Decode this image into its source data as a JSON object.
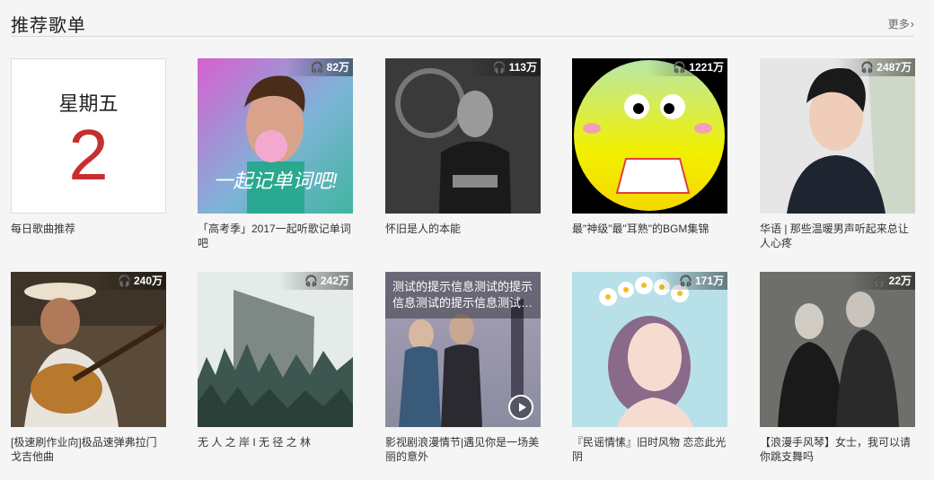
{
  "section": {
    "title": "推荐歌单",
    "more": "更多"
  },
  "daily": {
    "weekday": "星期五",
    "day": "2",
    "label": "每日歌曲推荐"
  },
  "playlists": [
    {
      "count": "82万",
      "label": "「高考季」2017一起听歌记单词吧",
      "cover_text": "一起记单词吧!"
    },
    {
      "count": "113万",
      "label": "怀旧是人的本能"
    },
    {
      "count": "1221万",
      "label": "最\"神级\"最\"耳熟\"的BGM集锦"
    },
    {
      "count": "2487万",
      "label": "华语 | 那些温暖男声听起来总让人心疼"
    },
    {
      "count": "240万",
      "label": "[极速刷作业向]极品速弹弗拉门戈吉他曲"
    },
    {
      "count": "242万",
      "label": "无 人 之 岸 I 无 径 之 林"
    },
    {
      "count": "",
      "label": "影视剧浪漫情节|遇见你是一场美丽的意外",
      "tooltip_line1": "测试的提示信息测试的提示",
      "tooltip_line2": "信息测试的提示信息测试的..."
    },
    {
      "count": "171万",
      "label": "『民谣情愫』旧时风物 恋恋此光阴"
    },
    {
      "count": "22万",
      "label": "【浪漫手风琴】女士，我可以请你跳支舞吗"
    }
  ],
  "icons": {
    "headphones": "headphones-icon",
    "more": "chevron-right-icon",
    "play": "play-icon"
  },
  "colors": {
    "accent_red": "#c62f2f"
  }
}
